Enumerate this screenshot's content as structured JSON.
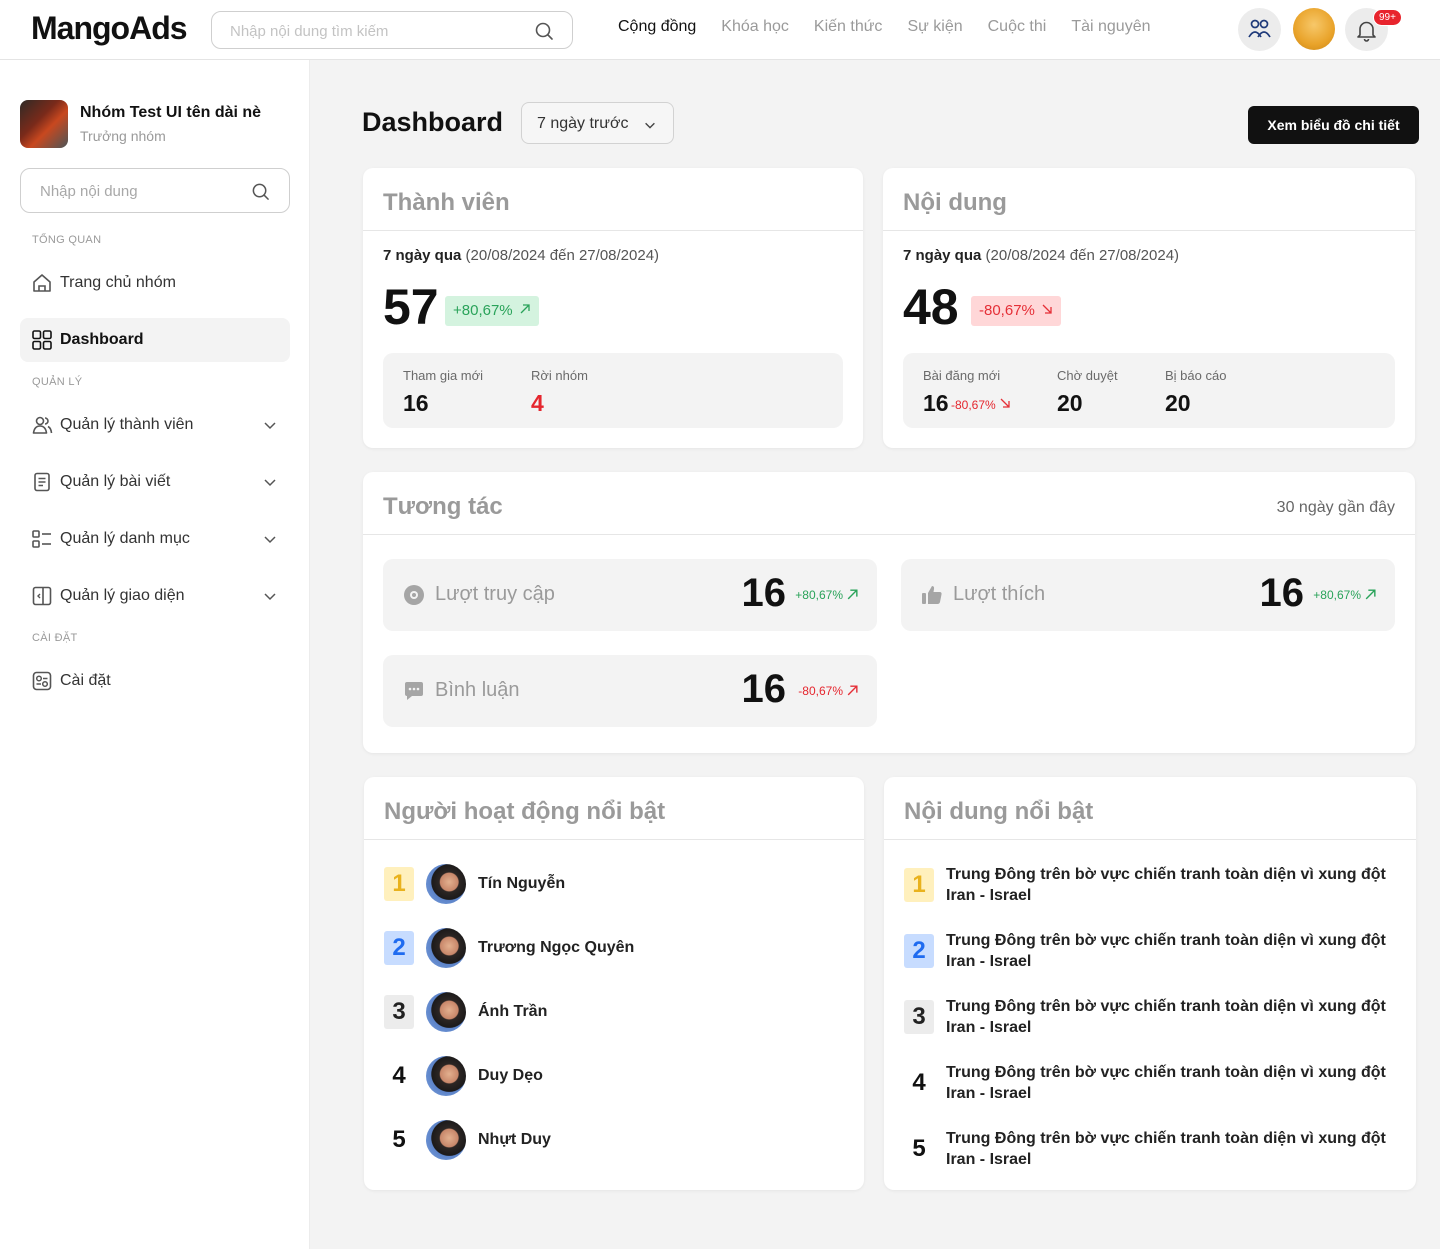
{
  "app": {
    "logo": "MangoAds"
  },
  "topbar": {
    "search_placeholder": "Nhập nội dung tìm kiếm",
    "nav": [
      "Cộng đồng",
      "Khóa học",
      "Kiến thức",
      "Sự kiện",
      "Cuộc thi",
      "Tài nguyên"
    ],
    "active_nav": "Cộng đồng",
    "notification_badge": "99+"
  },
  "sidebar": {
    "group_name": "Nhóm Test UI tên dài nè",
    "group_role": "Trưởng nhóm",
    "search_placeholder": "Nhập nội dung",
    "section_overview": "TỔNG QUAN",
    "section_manage": "QUẢN LÝ",
    "section_settings": "CÀI ĐẶT",
    "items": [
      {
        "label": "Trang chủ nhóm",
        "icon": "home-icon"
      },
      {
        "label": "Dashboard",
        "icon": "grid-icon",
        "active": true
      },
      {
        "label": "Quản lý thành viên",
        "icon": "users-icon",
        "expandable": true
      },
      {
        "label": "Quản lý bài viết",
        "icon": "document-icon",
        "expandable": true
      },
      {
        "label": "Quản lý danh mục",
        "icon": "category-icon",
        "expandable": true
      },
      {
        "label": "Quản lý giao diện",
        "icon": "layout-icon",
        "expandable": true
      },
      {
        "label": "Cài đặt",
        "icon": "settings-icon"
      }
    ]
  },
  "header": {
    "title": "Dashboard",
    "range_value": "7 ngày trước",
    "detail_button": "Xem biểu đồ chi tiết"
  },
  "members": {
    "title": "Thành viên",
    "period_bold": "7 ngày qua",
    "period_range": "(20/08/2024 đến 27/08/2024)",
    "total": "57",
    "delta": "+80,67%",
    "new_label": "Tham gia mới",
    "new_value": "16",
    "left_label": "Rời nhóm",
    "left_value": "4"
  },
  "content": {
    "title": "Nội dung",
    "period_bold": "7 ngày qua",
    "period_range": "(20/08/2024 đến 27/08/2024)",
    "total": "48",
    "delta": "-80,67%",
    "new_posts_label": "Bài đăng mới",
    "new_posts_value": "16",
    "new_posts_delta": "-80,67%",
    "pending_label": "Chờ duyệt",
    "pending_value": "20",
    "reported_label": "Bị báo cáo",
    "reported_value": "20"
  },
  "interaction": {
    "title": "Tương tác",
    "period": "30 ngày gần đây",
    "views": {
      "label": "Lượt truy cập",
      "value": "16",
      "delta": "+80,67%"
    },
    "likes": {
      "label": "Lượt thích",
      "value": "16",
      "delta": "+80,67%"
    },
    "comments": {
      "label": "Bình luận",
      "value": "16",
      "delta": "-80,67%"
    }
  },
  "top_members": {
    "title": "Người hoạt động nổi bật",
    "items": [
      {
        "rank": "1",
        "name": "Tín Nguyễn"
      },
      {
        "rank": "2",
        "name": "Trương Ngọc Quyên"
      },
      {
        "rank": "3",
        "name": "Ánh Trần"
      },
      {
        "rank": "4",
        "name": "Duy Dẹo"
      },
      {
        "rank": "5",
        "name": "Nhựt Duy"
      }
    ]
  },
  "top_content": {
    "title": "Nội dung nổi bật",
    "items": [
      {
        "rank": "1",
        "title": "Trung Đông trên bờ vực chiến tranh toàn diện vì xung đột Iran - Israel"
      },
      {
        "rank": "2",
        "title": "Trung Đông trên bờ vực chiến tranh toàn diện vì xung đột Iran - Israel"
      },
      {
        "rank": "3",
        "title": "Trung Đông trên bờ vực chiến tranh toàn diện vì xung đột Iran - Israel"
      },
      {
        "rank": "4",
        "title": "Trung Đông trên bờ vực chiến tranh toàn diện vì xung đột Iran - Israel"
      },
      {
        "rank": "5",
        "title": "Trung Đông trên bờ vực chiến tranh toàn diện vì xung đột Iran - Israel"
      }
    ]
  },
  "colors": {
    "up": "#2aa35a",
    "down": "#e5262e",
    "accent_dark": "#111111"
  }
}
